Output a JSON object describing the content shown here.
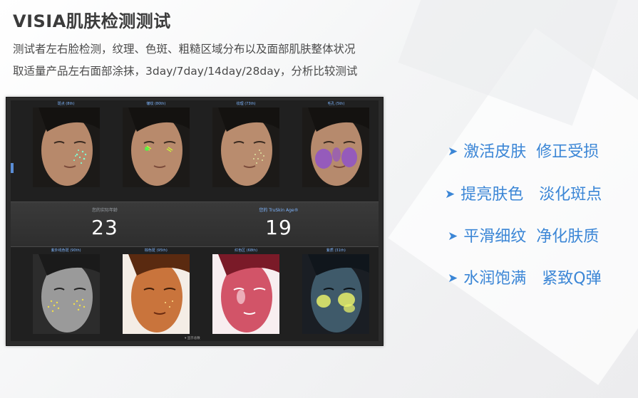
{
  "header": {
    "title": "VISIA肌肤检测测试",
    "line1": "测试者左右脸检测，纹理、色斑、粗糙区域分布以及面部肌肤整体状况",
    "line2": "取适量产品左右面部涂抹，3day/7day/14day/28day，分析比较测试"
  },
  "visia": {
    "top_labels": [
      "斑点 (8th)",
      "皱纹 (80th)",
      "纹理 (73th)",
      "毛孔 (5th)"
    ],
    "bottom_labels": [
      "紫外线色斑 (90th)",
      "棕色斑 (95th)",
      "红色区 (68th)",
      "紫质 (31th)"
    ],
    "real_age_label": "您的实际年龄",
    "real_age": "23",
    "truskin_label": "您的 TruSkin Age®",
    "truskin_age": "19",
    "more_label": "▾ 显示总数"
  },
  "benefits": [
    {
      "a": "激活皮肤",
      "b": "修正受损"
    },
    {
      "a": "提亮肤色",
      "b": "淡化斑点"
    },
    {
      "a": "平滑细纹",
      "b": "净化肤质"
    },
    {
      "a": "水润饱满",
      "b": "紧致Q弹"
    }
  ],
  "colors": {
    "accent": "#3b86d6",
    "title": "#3b3b3b",
    "panel": "#202020"
  },
  "icons": {
    "bullet": "triangle-right-icon"
  }
}
